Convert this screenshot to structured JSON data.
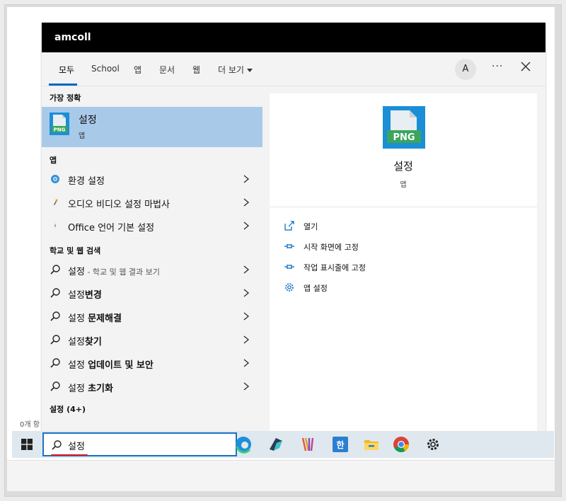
{
  "panel": {
    "title": "amcoll"
  },
  "tabs": [
    {
      "label": "모두"
    },
    {
      "label": "School"
    },
    {
      "label": "앱"
    },
    {
      "label": "문서"
    },
    {
      "label": "웹"
    },
    {
      "label": "더 보기"
    }
  ],
  "avatar_letter": "A",
  "more_label": "···",
  "best_match": {
    "heading": "가장 정확",
    "title": "설정",
    "subtitle": "앱",
    "icon_text": "PNG"
  },
  "apps": {
    "heading": "앱",
    "items": [
      {
        "label": "환경 설정"
      },
      {
        "label": "오디오 비디오 설정 마법사"
      },
      {
        "label": "Office 언어 기본 설정"
      }
    ]
  },
  "web": {
    "heading": "학교 및 웹 검색",
    "items": [
      {
        "plain": "설정",
        "bold": "",
        "sub": " - 학교 및 웹 결과 보기"
      },
      {
        "plain": "설정",
        "bold": "변경",
        "sub": ""
      },
      {
        "plain": "설정 ",
        "bold": "문제해결",
        "sub": ""
      },
      {
        "plain": "설정",
        "bold": "찾기",
        "sub": ""
      },
      {
        "plain": "설정 ",
        "bold": "업데이트 및 보안",
        "sub": ""
      },
      {
        "plain": "설정 ",
        "bold": "초기화",
        "sub": ""
      }
    ]
  },
  "settings_section": {
    "heading": "설정 (4+)"
  },
  "preview": {
    "icon_text": "PNG",
    "title": "설정",
    "subtitle": "앱",
    "actions": [
      {
        "label": "열기",
        "icon": "open-icon"
      },
      {
        "label": "시작 화면에 고정",
        "icon": "pin-icon"
      },
      {
        "label": "작업 표시줄에 고정",
        "icon": "pin-icon"
      },
      {
        "label": "앱 설정",
        "icon": "gear-icon"
      }
    ]
  },
  "files_count": "0개 항",
  "taskbar": {
    "search_value": "설정",
    "apps": [
      {
        "icon": "edge-icon"
      },
      {
        "icon": "app-arrow-icon"
      },
      {
        "icon": "app-stripes-icon"
      },
      {
        "icon": "hangul-icon",
        "text": "한"
      },
      {
        "icon": "file-explorer-icon"
      },
      {
        "icon": "chrome-icon"
      },
      {
        "icon": "settings-gear-icon"
      }
    ]
  },
  "colors": {
    "accent": "#0067c0",
    "selection": "#a9c9e9",
    "png_blue": "#1a8fd6",
    "png_green": "#3ba55c"
  }
}
